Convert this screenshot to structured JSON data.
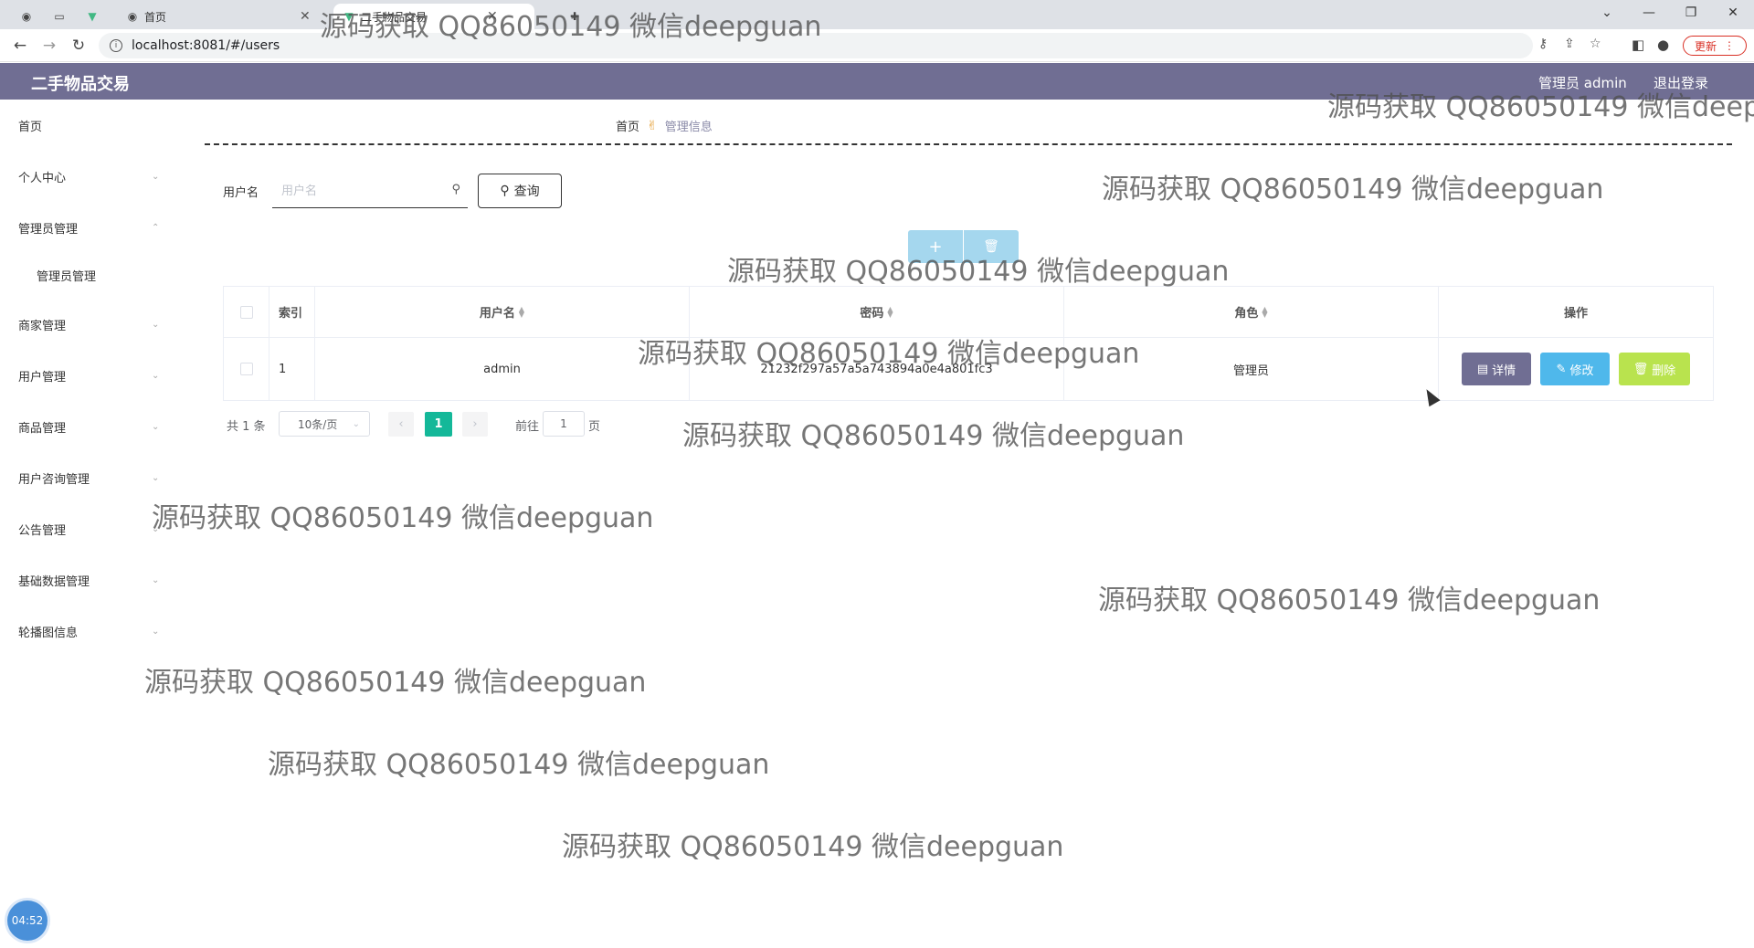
{
  "browser": {
    "tabs": [
      {
        "label": ""
      },
      {
        "label": ""
      },
      {
        "label": ""
      },
      {
        "label": "首页"
      },
      {
        "label": "二手物品交易"
      },
      {
        "label": ""
      }
    ],
    "url": "localhost:8081/#/users",
    "update_label": "更新"
  },
  "header": {
    "title": "二手物品交易",
    "user": "管理员 admin",
    "logout": "退出登录"
  },
  "sidebar": {
    "items": [
      {
        "label": "首页"
      },
      {
        "label": "个人中心"
      },
      {
        "label": "管理员管理"
      },
      {
        "label": "管理员管理"
      },
      {
        "label": "商家管理"
      },
      {
        "label": "用户管理"
      },
      {
        "label": "商品管理"
      },
      {
        "label": "用户咨询管理"
      },
      {
        "label": "公告管理"
      },
      {
        "label": "基础数据管理"
      },
      {
        "label": "轮播图信息"
      }
    ]
  },
  "breadcrumb": {
    "home": "首页",
    "current": "管理信息"
  },
  "search": {
    "label": "用户名",
    "placeholder": "用户名",
    "button": "查询"
  },
  "actions": {
    "add": "+",
    "delete": "🗑"
  },
  "table": {
    "headers": {
      "index": "索引",
      "username": "用户名",
      "password": "密码",
      "role": "角色",
      "ops": "操作"
    },
    "rows": [
      {
        "index": "1",
        "username": "admin",
        "password": "21232f297a57a5a743894a0e4a801fc3",
        "role": "管理员"
      }
    ],
    "ops": {
      "detail": "详情",
      "edit": "修改",
      "delete": "删除"
    }
  },
  "pagination": {
    "total": "共 1 条",
    "page_size": "10条/页",
    "current": "1",
    "goto": "前往",
    "goto_value": "1",
    "page_unit": "页"
  },
  "watermark": "源码获取 QQ86050149 微信deepguan",
  "timer": "04:52",
  "colors": {
    "header": "#706e93",
    "accent": "#14b899",
    "edit": "#4fb8eb",
    "delete": "#b9e34e"
  }
}
